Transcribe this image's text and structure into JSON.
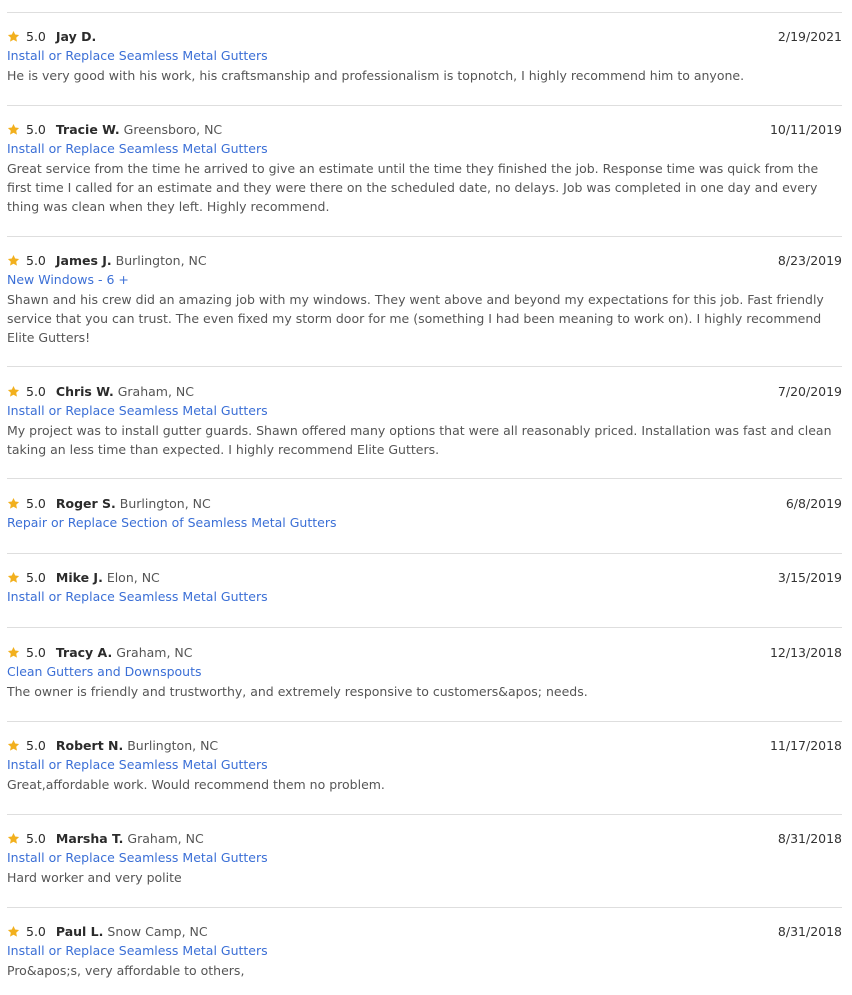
{
  "colors": {
    "star": "#f2b01e",
    "service_link": "#3b6fd6",
    "divider": "#dedede"
  },
  "reviews": [
    {
      "rating": "5.0",
      "name": "Jay D.",
      "location": "",
      "date": "2/19/2021",
      "service": "Install or Replace Seamless Metal Gutters",
      "text": "He is very good with his work, his craftsmanship and professionalism is topnotch, I highly recommend him to anyone."
    },
    {
      "rating": "5.0",
      "name": "Tracie W.",
      "location": "Greensboro, NC",
      "date": "10/11/2019",
      "service": "Install or Replace Seamless Metal Gutters",
      "text": "Great service from the time he arrived to give an estimate until the time they finished the job. Response time was quick from the first time I called for an estimate and they were there on the scheduled date, no delays. Job was completed in one day and every thing was clean when they left. Highly recommend."
    },
    {
      "rating": "5.0",
      "name": "James J.",
      "location": "Burlington, NC",
      "date": "8/23/2019",
      "service": "New Windows - 6 +",
      "text": "Shawn and his crew did an amazing job with my windows. They went above and beyond my expectations for this job. Fast friendly service that you can trust. The even fixed my storm door for me (something I had been meaning to work on). I highly recommend Elite Gutters!"
    },
    {
      "rating": "5.0",
      "name": "Chris W.",
      "location": "Graham, NC",
      "date": "7/20/2019",
      "service": "Install or Replace Seamless Metal Gutters",
      "text": "My project was to install gutter guards. Shawn offered many options that were all reasonably priced. Installation was fast and clean taking an less time than expected. I highly recommend Elite Gutters."
    },
    {
      "rating": "5.0",
      "name": "Roger S.",
      "location": "Burlington, NC",
      "date": "6/8/2019",
      "service": "Repair or Replace Section of Seamless Metal Gutters",
      "text": ""
    },
    {
      "rating": "5.0",
      "name": "Mike J.",
      "location": "Elon, NC",
      "date": "3/15/2019",
      "service": "Install or Replace Seamless Metal Gutters",
      "text": ""
    },
    {
      "rating": "5.0",
      "name": "Tracy A.",
      "location": "Graham, NC",
      "date": "12/13/2018",
      "service": "Clean Gutters and Downspouts",
      "text": "The owner is friendly and trustworthy, and extremely responsive to customers&apos; needs."
    },
    {
      "rating": "5.0",
      "name": "Robert N.",
      "location": "Burlington, NC",
      "date": "11/17/2018",
      "service": "Install or Replace Seamless Metal Gutters",
      "text": "Great,affordable work. Would recommend them no problem."
    },
    {
      "rating": "5.0",
      "name": "Marsha T.",
      "location": "Graham, NC",
      "date": "8/31/2018",
      "service": "Install or Replace Seamless Metal Gutters",
      "text": "Hard worker and very polite"
    },
    {
      "rating": "5.0",
      "name": "Paul L.",
      "location": "Snow Camp, NC",
      "date": "8/31/2018",
      "service": "Install or Replace Seamless Metal Gutters",
      "text": "Pro&apos;s, very affordable to others,"
    }
  ]
}
